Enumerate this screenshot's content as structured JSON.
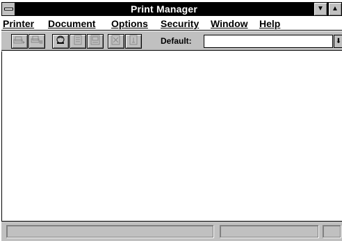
{
  "window": {
    "title": "Print Manager",
    "system_menu_icon": "system-menu-icon",
    "minimize_glyph": "▼",
    "maximize_glyph": "▲"
  },
  "menubar": {
    "items": [
      {
        "label": "Printer"
      },
      {
        "label": "Document"
      },
      {
        "label": "Options"
      },
      {
        "label": "Security"
      },
      {
        "label": "Window"
      },
      {
        "label": "Help"
      }
    ]
  },
  "toolbar": {
    "icons": [
      "printer-properties-icon",
      "pause-printer-icon",
      "document-details-icon",
      "pause-document-icon",
      "resume-document-icon",
      "delete-document-icon",
      "connect-printer-icon"
    ],
    "default_label": "Default:",
    "default_value": "",
    "dropdown_glyph": "⬇"
  },
  "statusbar": {
    "pane1": "",
    "pane2": "",
    "pane3": ""
  },
  "colors": {
    "titlebar_bg": "#000000",
    "chrome": "#c0c0c0",
    "client_bg": "#ffffff"
  }
}
